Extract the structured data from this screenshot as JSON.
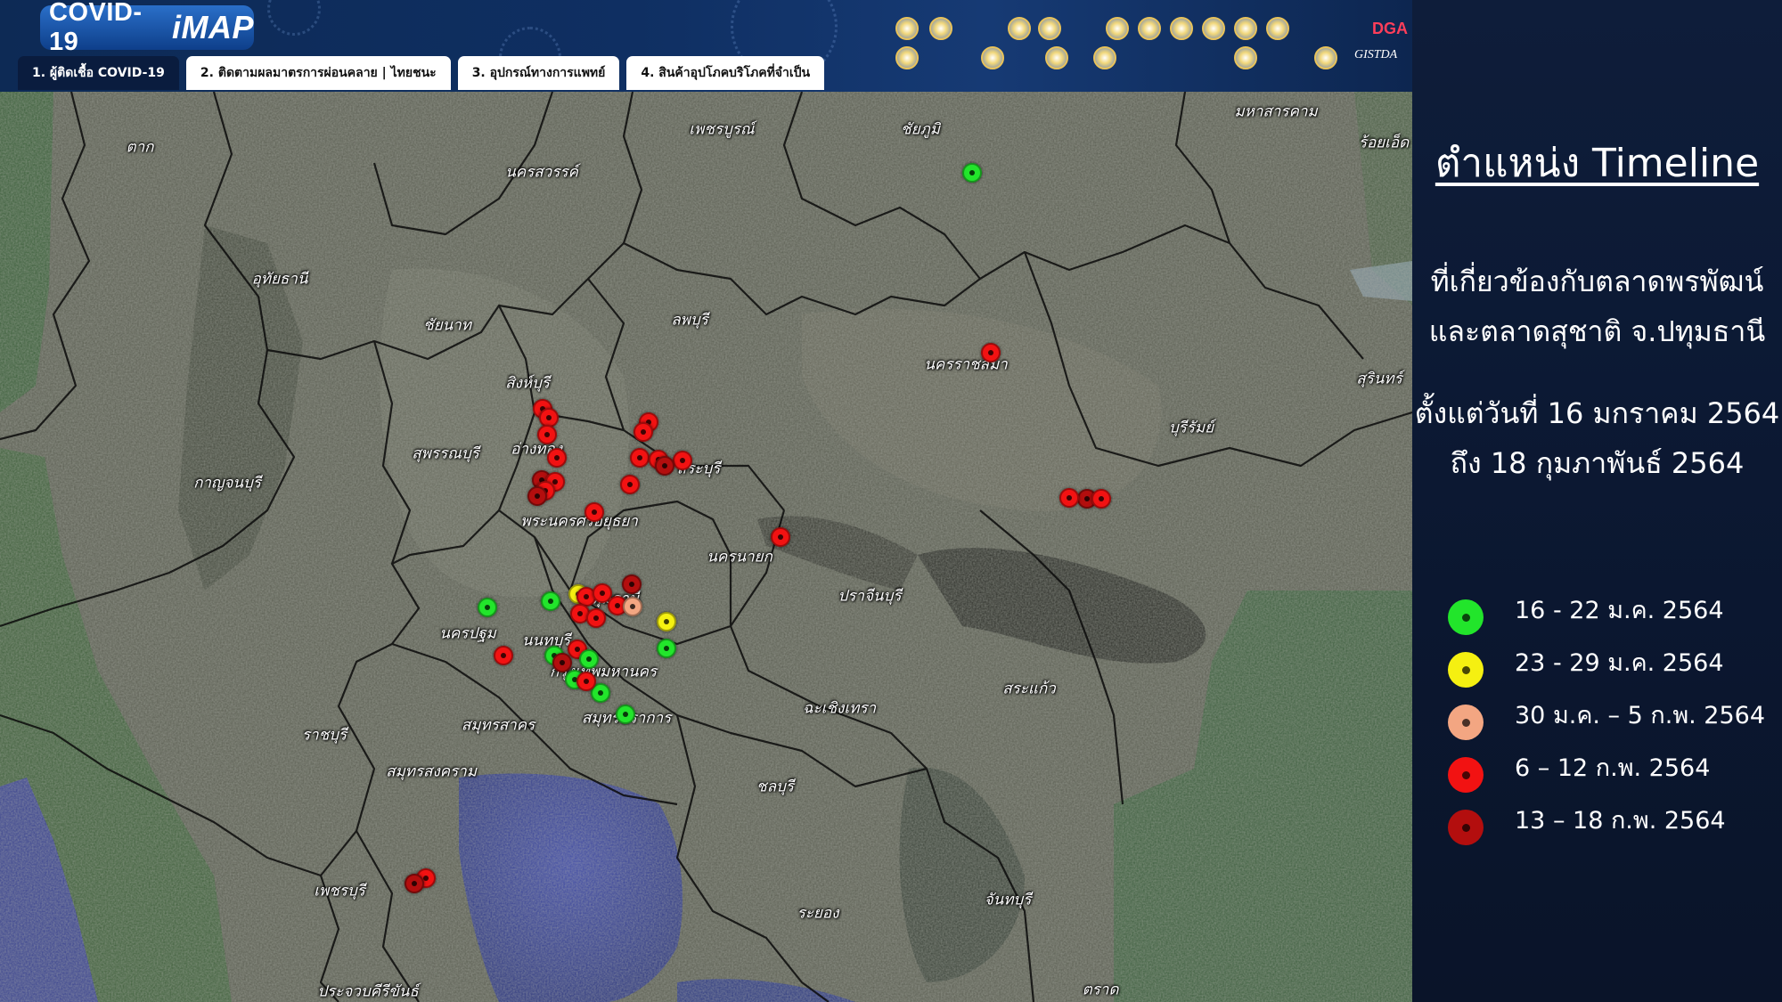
{
  "header": {
    "logo_text": "COVID-19",
    "logo_brand": "iMAP",
    "tabs": [
      {
        "label": "1. ผู้ติดเชื้อ COVID-19",
        "active": true
      },
      {
        "label": "2. ติดตามผลมาตรการผ่อนคลาย | ไทยชนะ",
        "active": false
      },
      {
        "label": "3. อุปกรณ์ทางการแพทย์",
        "active": false
      },
      {
        "label": "4. สินค้าอุปโภคบริโภคที่จำเป็น",
        "active": false
      }
    ],
    "partner_badge": "DGA",
    "partner_logo": "GISTDA"
  },
  "map": {
    "places": [
      "ตาก",
      "ชัยภูมิ",
      "มหาสารคาม",
      "ร้อยเอ็ด",
      "เพชรบูรณ์",
      "นครสวรรค์",
      "อุทัยธานี",
      "ชัยนาท",
      "ลพบุรี",
      "นครราชสีมา",
      "สิงห์บุรี",
      "อ่างทอง",
      "สุพรรณบุรี",
      "สระบุรี",
      "กาญจนบุรี",
      "สุรินทร์",
      "บุรีรัมย์",
      "พระนครศรีอยุธยา",
      "นครนายก",
      "ปทุมธานี",
      "ปราจีนบุรี",
      "นครปฐม",
      "นนทบุรี",
      "กรุงเทพมหานคร",
      "สมุทรปราการ",
      "สมุทรสาคร",
      "ฉะเชิงเทรา",
      "สระแก้ว",
      "ราชบุรี",
      "สมุทรสงคราม",
      "ชลบุรี",
      "เพชรบุรี",
      "ระยอง",
      "จันทบุรี",
      "ประจวบคีรีขันธ์",
      "ตราด"
    ],
    "markers": [
      {
        "period": "p1"
      },
      {
        "period": "p4"
      },
      {
        "period": "p4"
      },
      {
        "period": "p4"
      },
      {
        "period": "p4"
      },
      {
        "period": "p4"
      },
      {
        "period": "p5"
      },
      {
        "period": "p4"
      },
      {
        "period": "p4"
      },
      {
        "period": "p5"
      },
      {
        "period": "p4"
      },
      {
        "period": "p4"
      },
      {
        "period": "p4"
      },
      {
        "period": "p4"
      },
      {
        "period": "p4"
      },
      {
        "period": "p5"
      },
      {
        "period": "p4"
      },
      {
        "period": "p4"
      },
      {
        "period": "p4"
      },
      {
        "period": "p1"
      },
      {
        "period": "p1"
      },
      {
        "period": "p2"
      },
      {
        "period": "p4"
      },
      {
        "period": "p4"
      },
      {
        "period": "p5"
      },
      {
        "period": "p4"
      },
      {
        "period": "p3"
      },
      {
        "period": "p2"
      },
      {
        "period": "p4"
      },
      {
        "period": "p4"
      },
      {
        "period": "p4"
      },
      {
        "period": "p1"
      },
      {
        "period": "p1"
      },
      {
        "period": "p4"
      },
      {
        "period": "p5"
      },
      {
        "period": "p1"
      },
      {
        "period": "p1"
      },
      {
        "period": "p1"
      },
      {
        "period": "p1"
      },
      {
        "period": "p4"
      },
      {
        "period": "p5"
      },
      {
        "period": "p4"
      },
      {
        "period": "p4"
      },
      {
        "period": "p5"
      },
      {
        "period": "p4"
      }
    ]
  },
  "panel": {
    "title": "ตำแหน่ง Timeline",
    "description": [
      "ที่เกี่ยวข้องกับตลาดพรพัฒน์",
      "และตลาดสุชาติ จ.ปทุมธานี"
    ],
    "date_range": [
      "ตั้งแต่วันที่ 16 มกราคม 2564",
      "ถึง 18 กุมภาพันธ์ 2564"
    ],
    "legend": [
      {
        "id": "p1",
        "label": "16 - 22 ม.ค. 2564",
        "color": "#22e52b"
      },
      {
        "id": "p2",
        "label": "23 - 29 ม.ค. 2564",
        "color": "#f5f011"
      },
      {
        "id": "p3",
        "label": "30 ม.ค. – 5 ก.พ. 2564",
        "color": "#f3a682"
      },
      {
        "id": "p4",
        "label": "6 – 12 ก.พ. 2564",
        "color": "#f21212"
      },
      {
        "id": "p5",
        "label": "13 – 18 ก.พ. 2564",
        "color": "#b30e0e"
      }
    ]
  }
}
